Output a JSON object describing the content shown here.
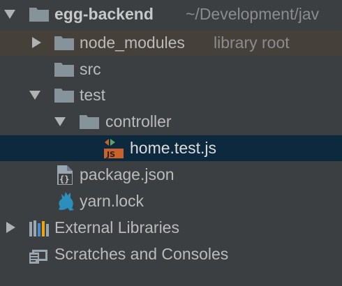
{
  "project": {
    "name": "egg-backend",
    "path": "~/Development/jav"
  },
  "tree": {
    "node_modules": {
      "label": "node_modules",
      "hint": "library root"
    },
    "src": {
      "label": "src"
    },
    "test": {
      "label": "test"
    },
    "controller": {
      "label": "controller"
    },
    "home_test": {
      "label": "home.test.js"
    },
    "package_json": {
      "label": "package.json"
    },
    "yarn_lock": {
      "label": "yarn.lock"
    },
    "external_libraries": {
      "label": "External Libraries"
    },
    "scratches": {
      "label": "Scratches and Consoles"
    }
  },
  "colors": {
    "background": "#3c3f41",
    "folder": "#87939a",
    "selected_row": "#0d293e",
    "highlight_row": "#45403a",
    "js_badge": "#c9612d"
  },
  "icons": {
    "folder": "folder-icon",
    "js_file": "js-test-file-icon",
    "json_file": "json-file-icon",
    "yarn_file": "yarn-cat-icon",
    "libraries": "libraries-icon",
    "scratches": "scratches-icon"
  }
}
